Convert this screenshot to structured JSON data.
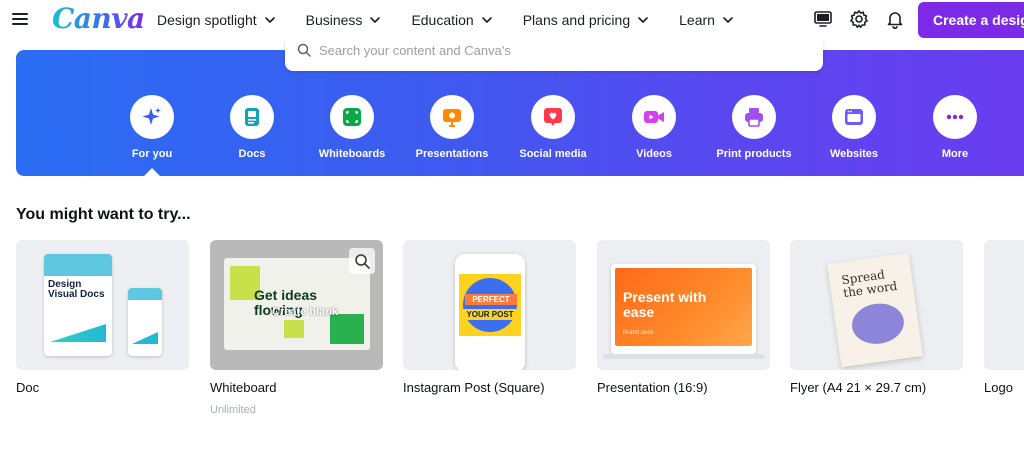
{
  "brand": {
    "logo_text": "Canva",
    "accent": "#7d2ae8"
  },
  "nav": {
    "items": [
      {
        "label": "Design spotlight"
      },
      {
        "label": "Business"
      },
      {
        "label": "Education"
      },
      {
        "label": "Plans and pricing"
      },
      {
        "label": "Learn"
      }
    ],
    "icons": [
      "desktop-icon",
      "gear-icon",
      "bell-icon"
    ],
    "create_button": "Create a design"
  },
  "search": {
    "placeholder": "Search your content and Canva's"
  },
  "categories": [
    {
      "label": "For you",
      "icon": "sparkle-icon",
      "color": "#3d5bf0",
      "selected": true
    },
    {
      "label": "Docs",
      "icon": "doc-icon",
      "color": "#13a3b5"
    },
    {
      "label": "Whiteboards",
      "icon": "whiteboard-icon",
      "color": "#0ba84a"
    },
    {
      "label": "Presentations",
      "icon": "presentation-icon",
      "color": "#ff8a00"
    },
    {
      "label": "Social media",
      "icon": "heart-icon",
      "color": "#ff3b4b"
    },
    {
      "label": "Videos",
      "icon": "video-icon",
      "color": "#d43ff0"
    },
    {
      "label": "Print products",
      "icon": "printer-icon",
      "color": "#a14ff0"
    },
    {
      "label": "Websites",
      "icon": "website-icon",
      "color": "#6e5bf5"
    },
    {
      "label": "More",
      "icon": "more-icon",
      "color": "#7d2ae8"
    }
  ],
  "suggestions": {
    "title": "You might want to try...",
    "items": [
      {
        "name": "Doc",
        "thumb_text": "Design Visual Docs"
      },
      {
        "name": "Whiteboard",
        "sub": "Unlimited",
        "thumb_text": "Get ideas flowing",
        "thumb_overlay": "Create blank"
      },
      {
        "name": "Instagram Post (Square)",
        "thumb_text_1": "PERFECT",
        "thumb_text_2": "YOUR POST"
      },
      {
        "name": "Presentation (16:9)",
        "thumb_text": "Present with ease",
        "thumb_sub": "Brand deck"
      },
      {
        "name": "Flyer (A4 21 × 29.7 cm)",
        "thumb_text": "Spread the word"
      },
      {
        "name": "Logo"
      }
    ]
  }
}
